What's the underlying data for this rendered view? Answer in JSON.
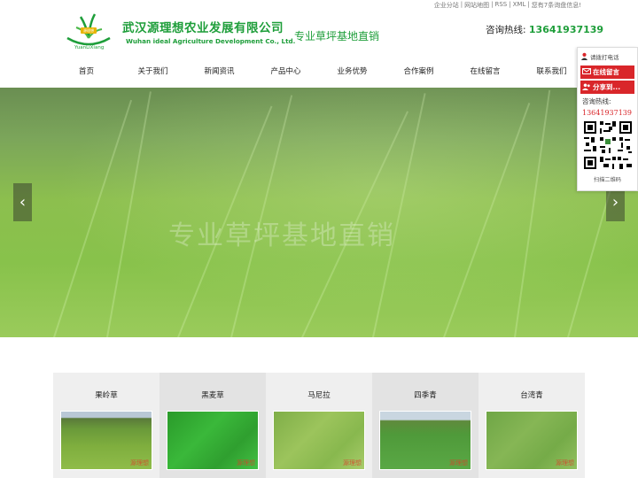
{
  "top_links": [
    "企业分站",
    "|",
    "网站地图",
    "|",
    "RSS",
    "|",
    "XML",
    "|",
    "您有7条询盘信息!"
  ],
  "header": {
    "logo_text": "YuanLiXiang",
    "logo_badge": "源理想",
    "company_cn": "武汉源理想农业发展有限公司",
    "company_en": "Wuhan ideal Agriculture Development Co., Ltd.",
    "slogan": "专业草坪基地直销",
    "hotline_label": "咨询热线:",
    "hotline_number": "13641937139"
  },
  "nav": [
    "首页",
    "关于我们",
    "新闻资讯",
    "产品中心",
    "业务优势",
    "合作案例",
    "在线留言",
    "联系我们"
  ],
  "banner": {
    "caption": "专业草坪基地直销",
    "prev": "‹",
    "next": "›"
  },
  "side_panel": {
    "call_label": "请拨打电话",
    "online_message": "在线留言",
    "share": "分享到...",
    "consult_label": "咨询热线:",
    "phone": "13641937139",
    "scan_label": "扫描二维码"
  },
  "products": [
    {
      "name": "果岭草",
      "watermark": "源理想"
    },
    {
      "name": "黑麦草",
      "watermark": "源理想"
    },
    {
      "name": "马尼拉",
      "watermark": "源理想"
    },
    {
      "name": "四季青",
      "watermark": "源理想"
    },
    {
      "name": "台湾青",
      "watermark": "源理想"
    }
  ],
  "colors": {
    "brand_green": "#1e9e3a",
    "accent_red": "#d9262a"
  }
}
